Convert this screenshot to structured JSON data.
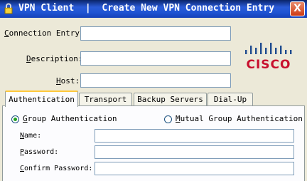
{
  "window": {
    "title": "VPN Client  |  Create New VPN Connection Entry",
    "close_label": "X"
  },
  "form": {
    "connection_entry_label_u": "C",
    "connection_entry_label_rest": "onnection Entry:",
    "connection_entry_value": "",
    "description_label_u": "D",
    "description_label_rest": "escription:",
    "description_value": "",
    "host_label_u": "H",
    "host_label_rest": "ost:",
    "host_value": ""
  },
  "logo": {
    "text": "CISCO",
    "color": "#c8102e",
    "bars_color": "#1f4c8f"
  },
  "tabs": [
    {
      "label": "Authentication"
    },
    {
      "label": "Transport"
    },
    {
      "label": "Backup Servers"
    },
    {
      "label": "Dial-Up"
    }
  ],
  "auth": {
    "group_auth_u": "G",
    "group_auth_rest": "roup Authentication",
    "group_auth_selected": true,
    "mutual_auth_u": "M",
    "mutual_auth_rest": "utual Group Authentication",
    "mutual_auth_selected": false,
    "name_label_u": "N",
    "name_label_rest": "ame:",
    "name_value": "",
    "password_label_u": "P",
    "password_label_rest": "assword:",
    "password_value": "",
    "confirm_label_u": "C",
    "confirm_label_rest": "onfirm Password:",
    "confirm_value": ""
  }
}
